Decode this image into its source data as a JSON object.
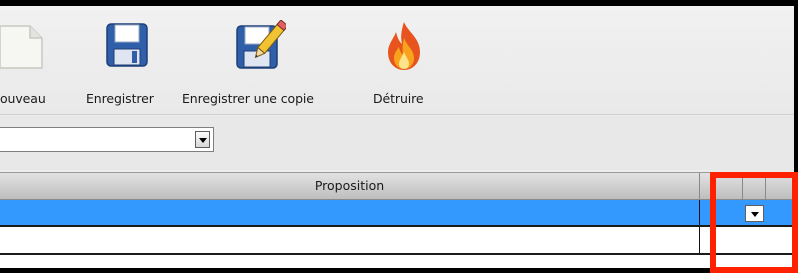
{
  "toolbar": {
    "nouveau_label": "ouveau",
    "enregistrer_label": "Enregistrer",
    "enregistrer_copie_label": "Enregistrer une copie",
    "detruire_label": "Détruire"
  },
  "filter": {
    "selected_value": ""
  },
  "grid": {
    "columns": [
      "Proposition"
    ],
    "rows": [
      {
        "proposition": "",
        "selected": true
      },
      {
        "proposition": "",
        "selected": false
      }
    ]
  },
  "colors": {
    "selection": "#3399ff",
    "highlight": "#ff2200"
  },
  "icons": [
    "new-document-icon",
    "save-disk-icon",
    "save-copy-icon",
    "fire-icon",
    "dropdown-arrow-icon"
  ]
}
